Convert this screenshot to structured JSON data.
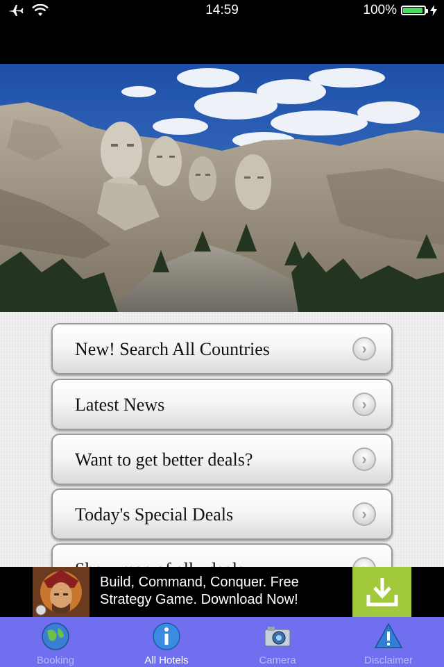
{
  "status": {
    "time": "14:59",
    "battery_pct": "100%",
    "battery_level": 1.0
  },
  "menu": [
    {
      "label": "New! Search All Countries"
    },
    {
      "label": "Latest News"
    },
    {
      "label": "Want to get better deals?"
    },
    {
      "label": "Today's Special Deals"
    },
    {
      "label": "Show map of all ydeals"
    }
  ],
  "ad": {
    "text": "Build, Command, Conquer. Free Strategy Game. Download Now!",
    "button_color": "#a2c93b"
  },
  "tabs": [
    {
      "label": "Booking",
      "icon": "globe-icon"
    },
    {
      "label": "All Hotels",
      "icon": "info-icon",
      "active": true
    },
    {
      "label": "Camera",
      "icon": "camera-icon"
    },
    {
      "label": "Disclaimer",
      "icon": "warning-icon"
    }
  ],
  "colors": {
    "tab_bar": "#6f6ff0",
    "battery": "#4cd964"
  }
}
